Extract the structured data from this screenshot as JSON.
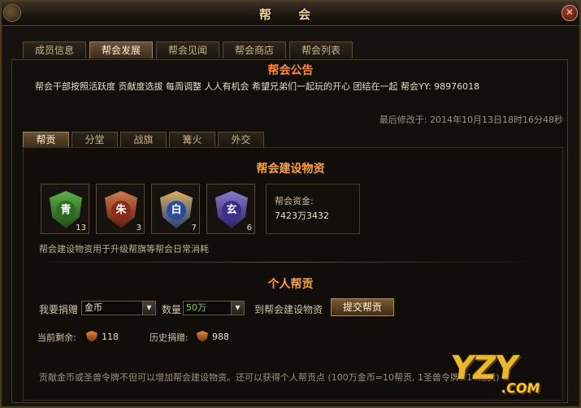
{
  "window": {
    "title": "帮 会"
  },
  "main_tabs": [
    "成员信息",
    "帮会发展",
    "帮会见闻",
    "帮会商店",
    "帮会列表"
  ],
  "active_main_tab": "帮会发展",
  "announcement": {
    "title": "帮会公告",
    "text": "帮会干部按照活跃度 贡献度选拔 每周调整 人人有机会 希望兄弟们一起玩的开心 团结在一起  帮会YY: 98976018",
    "last_modified": "最后修改于: 2014年10月13日18时16分48秒"
  },
  "sub_tabs": [
    "帮贡",
    "分堂",
    "战旗",
    "篝火",
    "外交"
  ],
  "active_sub_tab": "帮贡",
  "materials": {
    "title": "帮会建设物资",
    "items": [
      {
        "char": "青",
        "count": "13",
        "icon": "green-dragon-badge-icon",
        "color": "#3a8a3a"
      },
      {
        "char": "朱",
        "count": "3",
        "icon": "vermilion-bird-badge-icon",
        "color": "#b0402a"
      },
      {
        "char": "白",
        "count": "7",
        "icon": "white-tiger-badge-icon",
        "color": "#3a5aa8"
      },
      {
        "char": "玄",
        "count": "6",
        "icon": "black-tortoise-badge-icon",
        "color": "#5a4aa8"
      }
    ],
    "funds_label": "帮会资金:",
    "funds_value": "7423万3432",
    "note": "帮会建设物资用于升级帮旗等帮会日常消耗"
  },
  "personal": {
    "title": "个人帮贡",
    "donate_label": "我要捐赠",
    "donate_type": "金币",
    "quantity_label": "数量",
    "quantity_value": "50万",
    "to_label": "到帮会建设物资",
    "submit_label": "提交帮贡",
    "remaining_label": "当前剩余:",
    "remaining_value": "118",
    "history_label": "历史捐赠:",
    "history_value": "988",
    "footer_note": "贡献金币或圣兽令牌不但可以增加帮会建设物资。还可以获得个人帮贡点 (100万金币=10帮贡, 1圣兽令牌=10帮贡)"
  },
  "watermark": {
    "main": "YZY",
    "suffix": ".COM"
  }
}
